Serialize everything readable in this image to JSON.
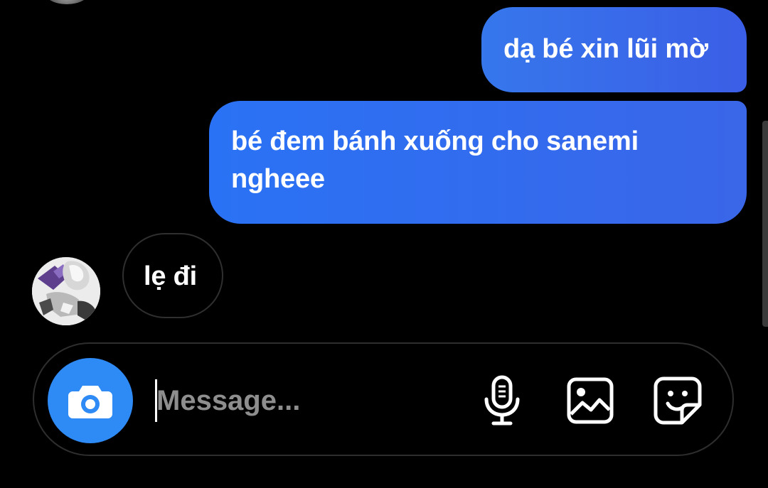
{
  "conversation": {
    "messages": [
      {
        "direction": "sent",
        "text": "dạ bé xin lũi mờ"
      },
      {
        "direction": "sent",
        "text": "bé đem bánh xuống cho sanemi ngheee"
      },
      {
        "direction": "received",
        "text": "lẹ đi"
      }
    ]
  },
  "composer": {
    "placeholder": "Message...",
    "value": "",
    "camera_icon": "camera-icon",
    "mic_icon": "microphone-icon",
    "gallery_icon": "gallery-icon",
    "sticker_icon": "sticker-icon"
  },
  "colors": {
    "sent_bubble": "#3a6fe8",
    "camera_button": "#2e8af5",
    "background": "#000000"
  }
}
